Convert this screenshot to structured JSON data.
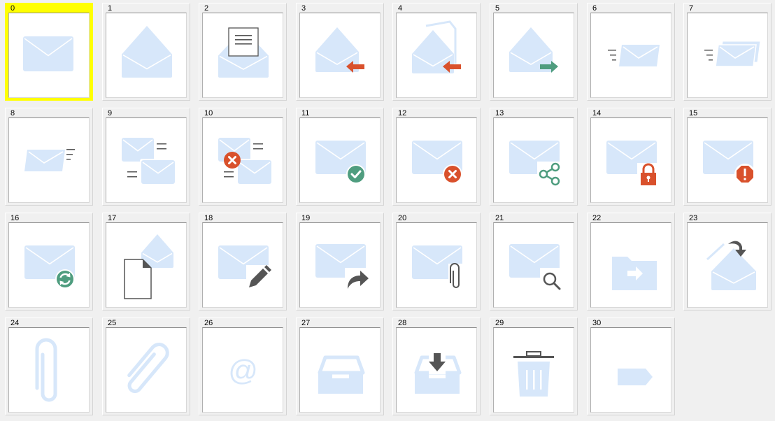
{
  "colors": {
    "selection": "#ffff00",
    "env_fill": "#d7e7fa",
    "env_line": "#ffffff",
    "red": "#d9512c",
    "green": "#4f9d7f",
    "gray": "#555555"
  },
  "selected_index": 0,
  "icons": [
    {
      "label": "0",
      "icon": "closed-envelope-icon"
    },
    {
      "label": "1",
      "icon": "open-envelope-icon"
    },
    {
      "label": "2",
      "icon": "open-envelope-with-letter-icon"
    },
    {
      "label": "3",
      "icon": "mail-reply-icon"
    },
    {
      "label": "4",
      "icon": "mail-reply-all-icon"
    },
    {
      "label": "5",
      "icon": "mail-forward-icon"
    },
    {
      "label": "6",
      "icon": "mail-send-fast-icon"
    },
    {
      "label": "7",
      "icon": "mail-send-multiple-icon"
    },
    {
      "label": "8",
      "icon": "mail-receive-fast-icon"
    },
    {
      "label": "9",
      "icon": "mail-multiple-icon"
    },
    {
      "label": "10",
      "icon": "mail-multiple-error-icon"
    },
    {
      "label": "11",
      "icon": "mail-check-icon"
    },
    {
      "label": "12",
      "icon": "mail-error-icon"
    },
    {
      "label": "13",
      "icon": "mail-share-icon"
    },
    {
      "label": "14",
      "icon": "mail-lock-icon"
    },
    {
      "label": "15",
      "icon": "mail-warning-icon"
    },
    {
      "label": "16",
      "icon": "mail-sync-icon"
    },
    {
      "label": "17",
      "icon": "document-mail-icon"
    },
    {
      "label": "18",
      "icon": "mail-edit-icon"
    },
    {
      "label": "19",
      "icon": "mail-forward-arrow-icon"
    },
    {
      "label": "20",
      "icon": "mail-attachment-icon"
    },
    {
      "label": "21",
      "icon": "mail-search-icon"
    },
    {
      "label": "22",
      "icon": "folder-move-icon"
    },
    {
      "label": "23",
      "icon": "mail-download-icon"
    },
    {
      "label": "24",
      "icon": "paperclip-icon"
    },
    {
      "label": "25",
      "icon": "paperclip-diagonal-icon"
    },
    {
      "label": "26",
      "icon": "at-sign-icon"
    },
    {
      "label": "27",
      "icon": "inbox-tray-icon"
    },
    {
      "label": "28",
      "icon": "inbox-download-icon"
    },
    {
      "label": "29",
      "icon": "trash-can-icon"
    },
    {
      "label": "30",
      "icon": "tag-icon"
    }
  ]
}
